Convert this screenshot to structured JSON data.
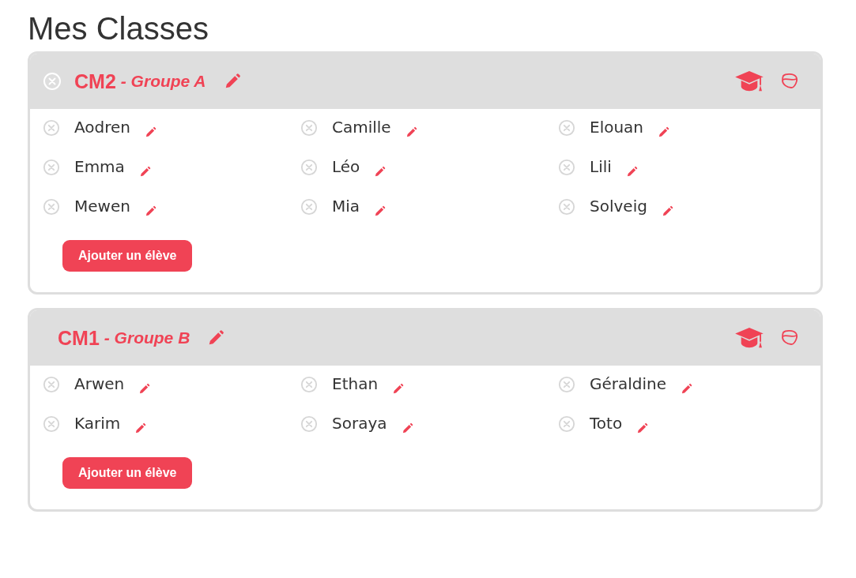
{
  "title": "Mes Classes",
  "classes": [
    {
      "name": "CM2",
      "group": "- Groupe A",
      "removable": true,
      "students": [
        "Aodren",
        "Camille",
        "Elouan",
        "Emma",
        "Léo",
        "Lili",
        "Mewen",
        "Mia",
        "Solveig"
      ],
      "add_button": "Ajouter un élève"
    },
    {
      "name": "CM1",
      "group": "- Groupe B",
      "removable": false,
      "students": [
        "Arwen",
        "Ethan",
        "Géraldine",
        "Karim",
        "Soraya",
        "Toto"
      ],
      "add_button": "Ajouter un élève"
    }
  ]
}
